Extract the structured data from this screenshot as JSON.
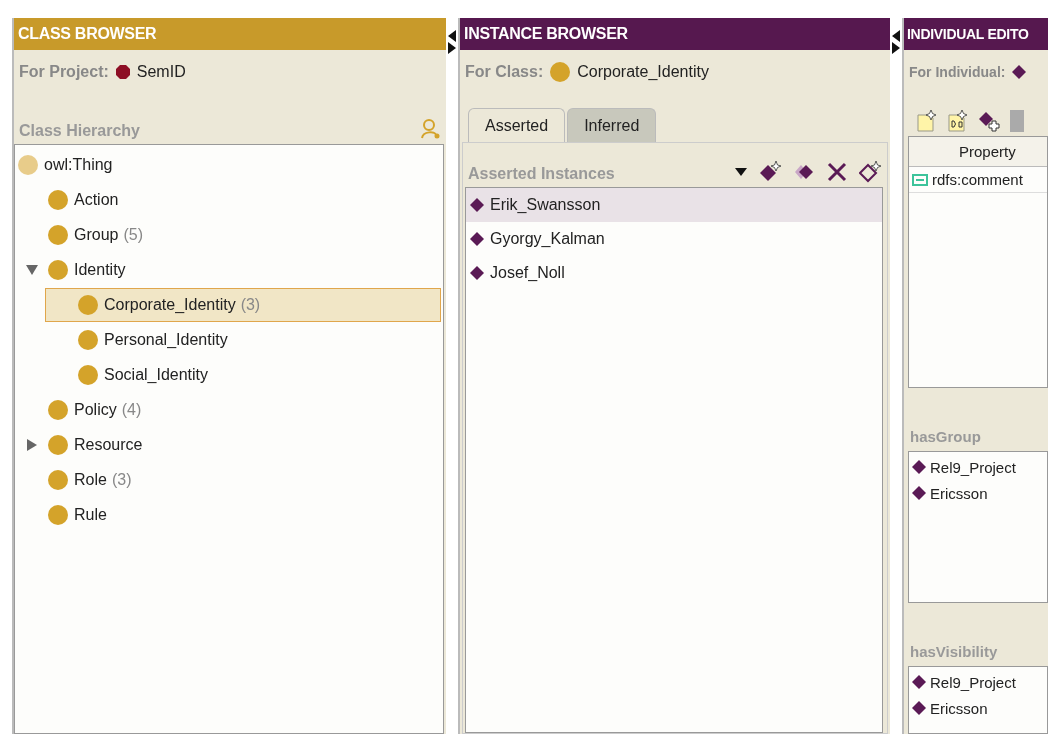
{
  "class_browser": {
    "title": "CLASS BROWSER",
    "project_label": "For Project:",
    "project": "SemID",
    "hierarchy_label": "Class Hierarchy",
    "tree": [
      {
        "label": "owl:Thing",
        "kind": "root",
        "selected": false,
        "children": [
          {
            "label": "Action",
            "kind": "class",
            "selected": false
          },
          {
            "label": "Group",
            "count": "(5)",
            "kind": "class",
            "selected": false
          },
          {
            "label": "Identity",
            "kind": "class",
            "expanded": true,
            "selected": false,
            "children": [
              {
                "label": "Corporate_Identity",
                "count": "(3)",
                "kind": "class",
                "selected": true
              },
              {
                "label": "Personal_Identity",
                "kind": "class",
                "selected": false
              },
              {
                "label": "Social_Identity",
                "kind": "class",
                "selected": false
              }
            ]
          },
          {
            "label": "Policy",
            "count": "(4)",
            "kind": "class",
            "selected": false
          },
          {
            "label": "Resource",
            "kind": "class",
            "expanded": false,
            "selected": false
          },
          {
            "label": "Role",
            "count": "(3)",
            "kind": "class",
            "selected": false
          },
          {
            "label": "Rule",
            "kind": "class",
            "selected": false
          }
        ]
      }
    ]
  },
  "instance_browser": {
    "title": "INSTANCE BROWSER",
    "class_label": "For Class:",
    "class": "Corporate_Identity",
    "tabs": [
      {
        "label": "Asserted",
        "selected": true
      },
      {
        "label": "Inferred",
        "selected": false
      }
    ],
    "list_label": "Asserted Instances",
    "instances": [
      {
        "name": "Erik_Swansson",
        "selected": true
      },
      {
        "name": "Gyorgy_Kalman",
        "selected": false
      },
      {
        "name": "Josef_Noll",
        "selected": false
      }
    ]
  },
  "individual_editor": {
    "title": "INDIVIDUAL EDITO",
    "individual_label": "For Individual:",
    "table": {
      "columns": [
        "Property"
      ],
      "rows": [
        {
          "property": "rdfs:comment"
        }
      ]
    },
    "slots": [
      {
        "label": "hasGroup",
        "values": [
          "Rel9_Project",
          "Ericsson"
        ]
      },
      {
        "label": "hasVisibility",
        "values": [
          "Rel9_Project",
          "Ericsson"
        ]
      }
    ]
  }
}
